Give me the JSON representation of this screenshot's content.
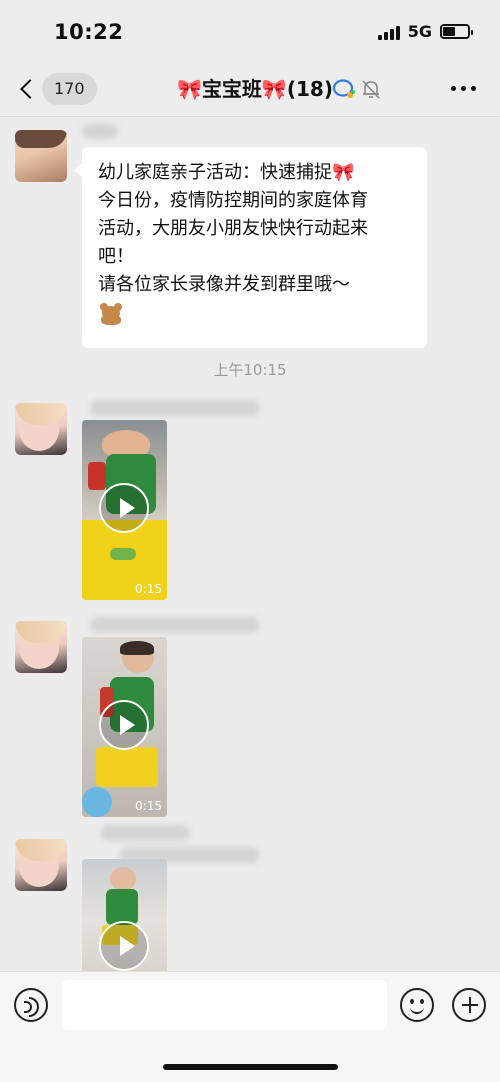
{
  "status_bar": {
    "time": "10:22",
    "network": "5G"
  },
  "nav": {
    "back_count": "170",
    "title": "🎀宝宝班🎀",
    "member_count": "(18)"
  },
  "messages": [
    {
      "type": "text",
      "lines": [
        "幼儿家庭亲子活动：快速捕捉🎀",
        "今日份，疫情防控期间的家庭体育",
        "活动，大朋友小朋友快快行动起来",
        "吧！",
        "请各位家长录像并发到群里哦～"
      ],
      "trailing_emoji": "teddy-bear"
    },
    {
      "type": "timestamp",
      "text": "上午10:15"
    },
    {
      "type": "video",
      "duration": "0:15"
    },
    {
      "type": "video",
      "duration": "0:15"
    },
    {
      "type": "video",
      "duration": ""
    }
  ],
  "input_bar": {
    "placeholder": ""
  },
  "colors": {
    "background": "#ececec",
    "bubble": "#ffffff",
    "accent": "#e86c8c"
  }
}
